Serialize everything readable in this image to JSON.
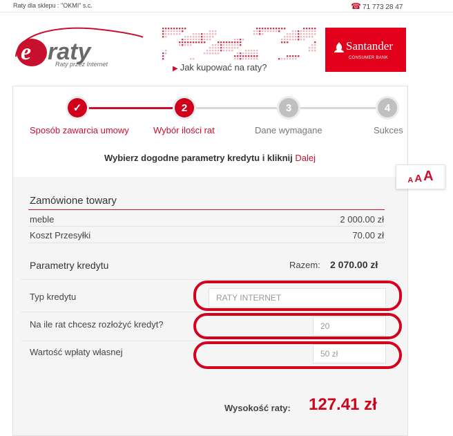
{
  "topbar": {
    "store": "Raty dla sklepu : \"OKMI\" s.c.",
    "phone_icon": "phone-icon",
    "phone": "71 773 28 47"
  },
  "brand": {
    "logo_text": "eraty",
    "tagline": "Raty przez Internet",
    "howto_link": "Jak kupować na raty?",
    "bank_name": "Santander",
    "bank_sub": "CONSUMER BANK",
    "accent": "#c8102e"
  },
  "steps": [
    {
      "number": "✓",
      "label": "Sposób zawarcia umowy",
      "state": "done"
    },
    {
      "number": "2",
      "label": "Wybór ilości rat",
      "state": "active"
    },
    {
      "number": "3",
      "label": "Dane wymagane",
      "state": "todo"
    },
    {
      "number": "4",
      "label": "Sukces",
      "state": "todo"
    }
  ],
  "instruction": {
    "text": "Wybierz dogodne parametry kredytu i kliknij ",
    "link": "Dalej"
  },
  "font_size": {
    "small": "A",
    "medium": "A",
    "large": "A"
  },
  "order": {
    "title": "Zamówione towary",
    "items": [
      {
        "label": "meble",
        "value": "2 000.00 zł"
      },
      {
        "label": "Koszt Przesyłki",
        "value": "70.00 zł"
      }
    ]
  },
  "credit": {
    "title": "Parametry kredytu",
    "total_label": "Razem:",
    "total_value": "2 070.00 zł",
    "type_label": "Typ kredytu",
    "type_value": "RATY INTERNET",
    "installments_label": "Na ile rat chcesz rozłożyć kredyt?",
    "installments_value": "20",
    "down_payment_label": "Wartość wpłaty własnej",
    "down_payment_value": "50 zł"
  },
  "rate": {
    "label": "Wysokość raty:",
    "value": "127.41 zł"
  }
}
